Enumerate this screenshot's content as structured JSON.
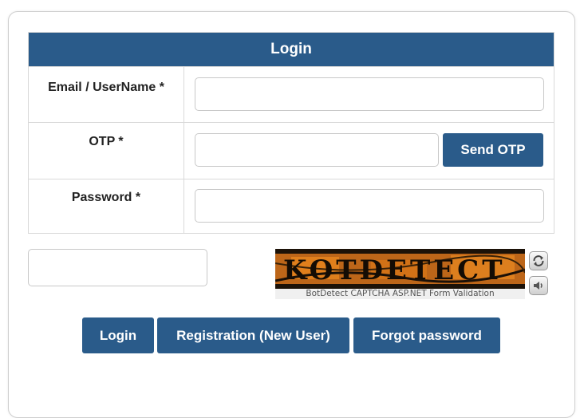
{
  "form": {
    "title": "Login",
    "fields": [
      {
        "label": "Email / UserName *",
        "value": "",
        "placeholder": ""
      },
      {
        "label": "OTP *",
        "value": "",
        "placeholder": ""
      },
      {
        "label": "Password *",
        "value": "",
        "placeholder": ""
      }
    ],
    "send_otp_label": "Send OTP"
  },
  "captcha": {
    "input_value": "",
    "image_text": "KOTDETECT",
    "caption": "BotDetect CAPTCHA ASP.NET Form Validation",
    "reload_icon": "reload-icon",
    "sound_icon": "speaker-icon"
  },
  "actions": {
    "login_label": "Login",
    "register_label": "Registration (New User)",
    "forgot_label": "Forgot password"
  },
  "colors": {
    "primary": "#2a5b8a",
    "border": "#d9d9d9"
  }
}
